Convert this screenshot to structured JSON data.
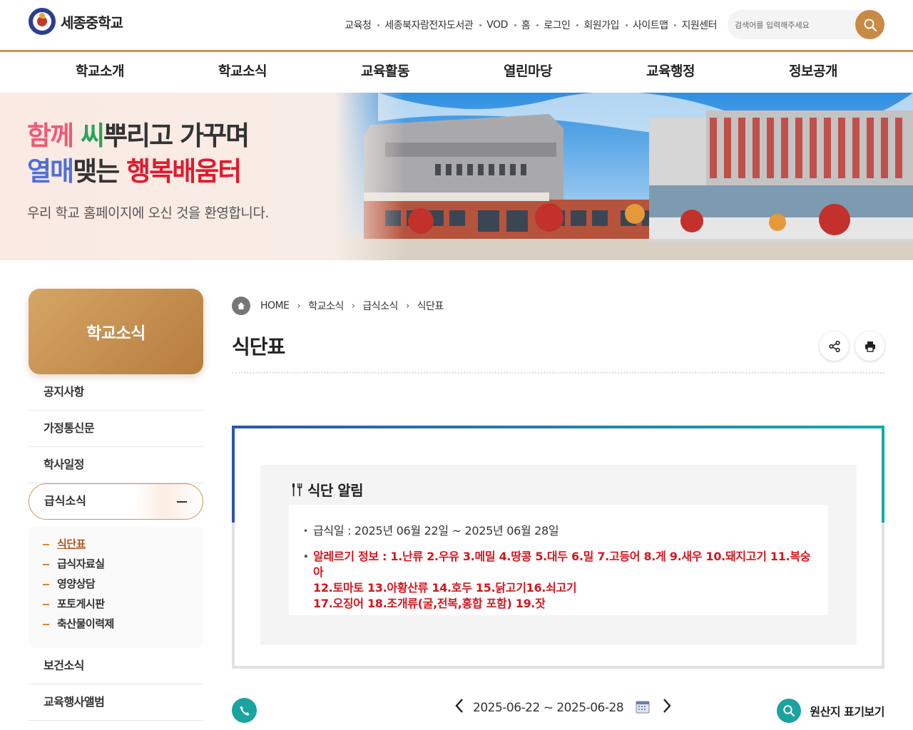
{
  "header": {
    "school_name": "세종중학교",
    "util_links": [
      "교육청",
      "세종북자람전자도서관",
      "VOD",
      "홈",
      "로그인",
      "회원가입",
      "사이트맵",
      "지원센터"
    ],
    "search_placeholder": "검색어를 입력해주세요"
  },
  "gnb": [
    "학교소개",
    "학교소식",
    "교육활동",
    "열린마당",
    "교육행정",
    "정보공개"
  ],
  "visual": {
    "slogan_1a": "함께 ",
    "slogan_1b": "씨",
    "slogan_1c": "뿌리고 가꾸며",
    "slogan_2a": "열매",
    "slogan_2b": "맺는 ",
    "slogan_2c": "행복배움터",
    "welcome": "우리 학교 홈페이지에 오신 것을 환영합니다."
  },
  "lnb": {
    "title": "학교소식",
    "items_top": [
      "공지사항",
      "가정통신문",
      "학사일정"
    ],
    "active": "급식소식",
    "sub_items": [
      "식단표",
      "급식자료실",
      "영양상담",
      "포토게시판",
      "축산물이력제"
    ],
    "items_bottom": [
      "보건소식",
      "교육행사앨범"
    ]
  },
  "breadcrumb": [
    "HOME",
    "학교소식",
    "급식소식",
    "식단표"
  ],
  "page_title": "식단표",
  "notice": {
    "heading": "식단 알림",
    "date_line": "급식일 : 2025년 06월 22일 ~ 2025년 06월 28일",
    "allergy_1": "알레르기 정보 : 1.난류 2.우유 3.메밀 4.땅콩 5.대두 6.밀 7.고등어 8.게 9.새우 10.돼지고기 11.복숭아",
    "allergy_2": "12.토마토 13.아황산류 14.호두 15.닭고기16.쇠고기",
    "allergy_3": "17.오징어 18.조개류(굴,전복,홍합 포함) 19.잣"
  },
  "bottom": {
    "week_range": "2025-06-22 ~ 2025-06-28",
    "origin_label": "원산지 표기보기"
  },
  "colors": {
    "accent": "#c8965c",
    "teal": "#1ba3a0",
    "allergy_red": "#d5161c"
  }
}
